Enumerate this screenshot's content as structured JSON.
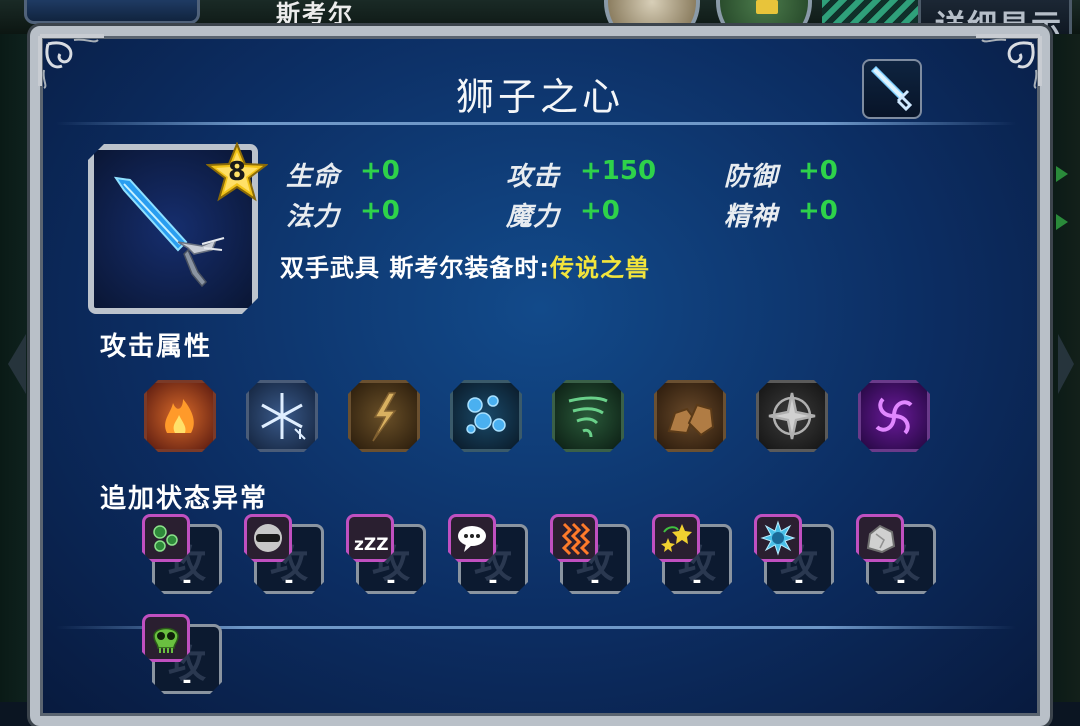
{
  "top_bar": {
    "character_name": "斯考尔",
    "detail_button": "详细显示"
  },
  "dialog": {
    "title": "狮子之心",
    "item": {
      "rank": "8"
    },
    "stats": [
      {
        "label": "生命",
        "value": "+0"
      },
      {
        "label": "法力",
        "value": "+0"
      },
      {
        "label": "攻击",
        "value": "+150"
      },
      {
        "label": "魔力",
        "value": "+0"
      },
      {
        "label": "防御",
        "value": "+0"
      },
      {
        "label": "精神",
        "value": "+0"
      }
    ],
    "equip_note": {
      "prefix": "双手武具 斯考尔装备时:",
      "highlight": "传说之兽"
    },
    "attack_attributes": {
      "heading": "攻击属性",
      "elements": [
        {
          "icon": "fire-icon",
          "color": "#c83c1e"
        },
        {
          "icon": "ice-icon",
          "color": "#9ab8e8"
        },
        {
          "icon": "thunder-icon",
          "color": "#b08c3c"
        },
        {
          "icon": "water-icon",
          "color": "#2a7ab8"
        },
        {
          "icon": "wind-icon",
          "color": "#3c8c4a"
        },
        {
          "icon": "earth-icon",
          "color": "#8a6838"
        },
        {
          "icon": "holy-icon",
          "color": "#707070"
        },
        {
          "icon": "dark-icon",
          "color": "#8c2cb8"
        }
      ]
    },
    "status_ailments": {
      "heading": "追加状态异常",
      "slot_mark": "攻",
      "slots": [
        {
          "icon": "poison-icon",
          "value": "-"
        },
        {
          "icon": "blind-icon",
          "value": "-"
        },
        {
          "icon": "sleep-icon",
          "value": "-",
          "text": "zZZ"
        },
        {
          "icon": "silence-icon",
          "value": "-"
        },
        {
          "icon": "berserk-icon",
          "value": "-"
        },
        {
          "icon": "confuse-icon",
          "value": "-"
        },
        {
          "icon": "slow-icon",
          "value": "-"
        },
        {
          "icon": "petrify-icon",
          "value": "-"
        },
        {
          "icon": "death-icon",
          "value": "-"
        }
      ]
    }
  }
}
